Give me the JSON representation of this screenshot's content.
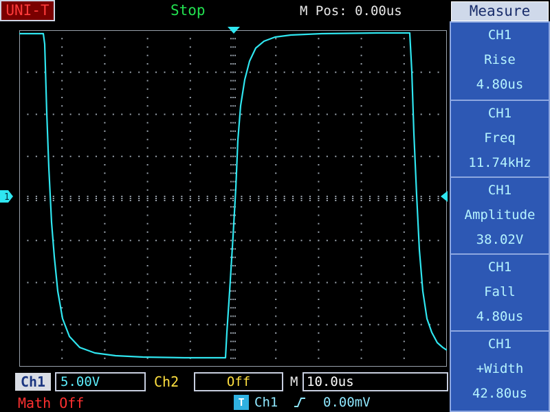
{
  "header": {
    "brand": "UNI-T",
    "status": "Stop",
    "m_pos": "M Pos: 0.00us"
  },
  "menu": {
    "title": "Measure",
    "items": [
      {
        "source": "CH1",
        "name": "Rise",
        "value": "4.80us"
      },
      {
        "source": "CH1",
        "name": "Freq",
        "value": "11.74kHz"
      },
      {
        "source": "CH1",
        "name": "Amplitude",
        "value": "38.02V"
      },
      {
        "source": "CH1",
        "name": "Fall",
        "value": "4.80us"
      },
      {
        "source": "CH1",
        "name": "+Width",
        "value": "42.80us"
      }
    ]
  },
  "channel_marker": "1",
  "bottom": {
    "ch1_label": "Ch1",
    "ch1_volts_div": "5.00V",
    "ch2_label": "Ch2",
    "ch2_state": "Off",
    "m_label": "M",
    "timebase": "10.0us",
    "math": "Math Off",
    "trigger_icon": "T",
    "trigger_source": "Ch1",
    "trigger_level": "0.00mV"
  },
  "colors": {
    "trace": "#2fe6f0",
    "grid": "#9aa3ad",
    "status": "#22e050",
    "panel": "#2d58b4",
    "brand": "#ff3b3b"
  },
  "icons": {
    "channel_marker": "ch1-ground-marker-icon",
    "trigger_position": "trigger-position-marker-icon",
    "trigger_level": "trigger-level-marker-icon",
    "slope": "rising-edge-icon"
  }
}
